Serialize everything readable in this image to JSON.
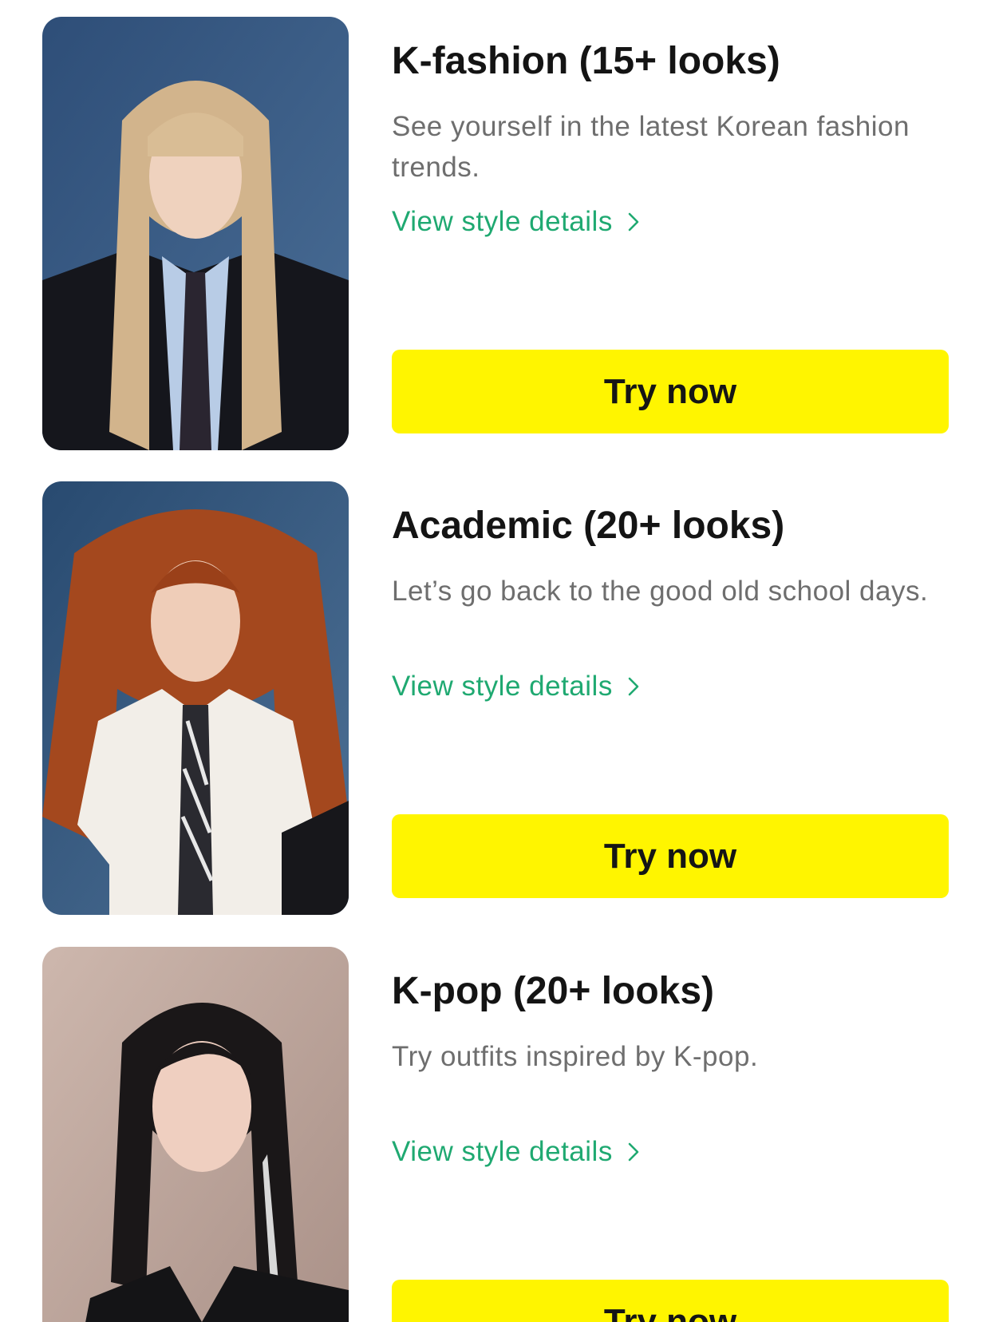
{
  "styles": [
    {
      "title": "K-fashion (15+ looks)",
      "description": "See yourself in the latest Korean fashion trends.",
      "details_link": "View style details",
      "button": "Try now",
      "thumbnail": "portrait-blonde-hair-school-uniform"
    },
    {
      "title": "Academic (20+ looks)",
      "description": "Let’s go back to the good old school days.",
      "details_link": "View style details",
      "button": "Try now",
      "thumbnail": "portrait-red-hair-white-shirt-tie"
    },
    {
      "title": "K-pop (20+ looks)",
      "description": "Try outfits inspired by K-pop.",
      "details_link": "View style details",
      "button": "Try now",
      "thumbnail": "portrait-black-hair-black-blazer"
    }
  ],
  "colors": {
    "button_bg": "#FFF500",
    "link": "#1FA971",
    "title": "#141414",
    "description": "#6E6E6E"
  }
}
